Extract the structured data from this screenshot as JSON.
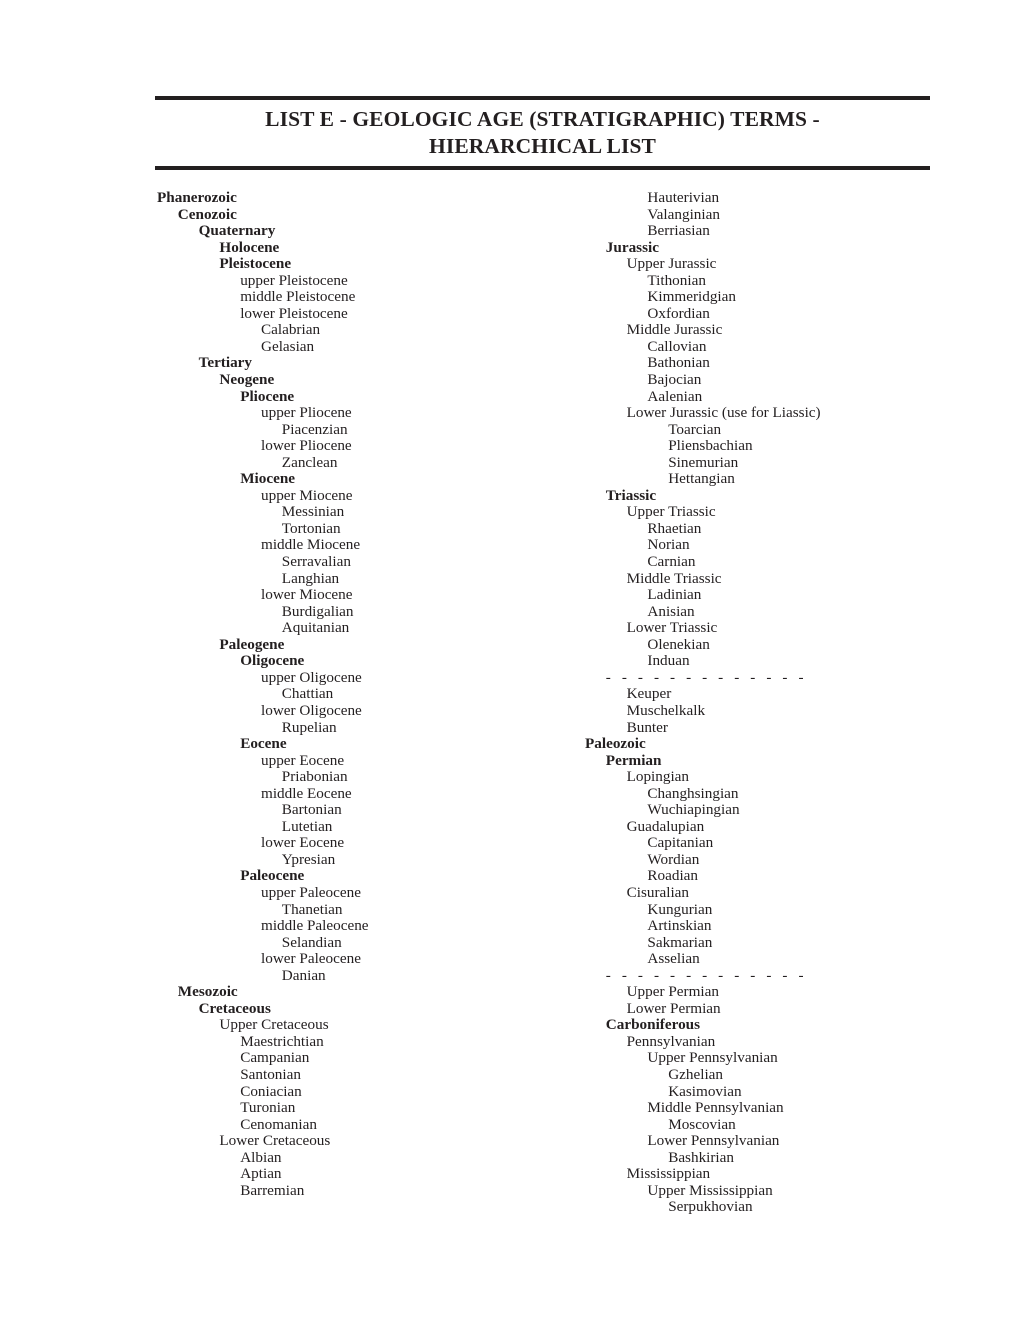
{
  "document": {
    "title_line_1": "LIST E - GEOLOGIC AGE (STRATIGRAPHIC) TERMS -",
    "title_line_2": "HIERARCHICAL LIST",
    "rule_color": "#231f20",
    "text_color": "#231f20",
    "background_color": "#ffffff"
  },
  "left_column": [
    {
      "label": "Phanerozoic",
      "level": 0,
      "bold": true
    },
    {
      "label": "Cenozoic",
      "level": 1,
      "bold": true
    },
    {
      "label": "Quaternary",
      "level": 2,
      "bold": true
    },
    {
      "label": "Holocene",
      "level": 3,
      "bold": true
    },
    {
      "label": "Pleistocene",
      "level": 3,
      "bold": true
    },
    {
      "label": "upper Pleistocene",
      "level": 4,
      "bold": false
    },
    {
      "label": "middle Pleistocene",
      "level": 4,
      "bold": false
    },
    {
      "label": "lower Pleistocene",
      "level": 4,
      "bold": false
    },
    {
      "label": "Calabrian",
      "level": 5,
      "bold": false
    },
    {
      "label": "Gelasian",
      "level": 5,
      "bold": false
    },
    {
      "label": "Tertiary",
      "level": 2,
      "bold": true
    },
    {
      "label": "Neogene",
      "level": 3,
      "bold": true
    },
    {
      "label": "Pliocene",
      "level": 4,
      "bold": true
    },
    {
      "label": "upper Pliocene",
      "level": 5,
      "bold": false
    },
    {
      "label": "Piacenzian",
      "level": 6,
      "bold": false
    },
    {
      "label": "lower Pliocene",
      "level": 5,
      "bold": false
    },
    {
      "label": "Zanclean",
      "level": 6,
      "bold": false
    },
    {
      "label": "Miocene",
      "level": 4,
      "bold": true
    },
    {
      "label": "upper Miocene",
      "level": 5,
      "bold": false
    },
    {
      "label": "Messinian",
      "level": 6,
      "bold": false
    },
    {
      "label": "Tortonian",
      "level": 6,
      "bold": false
    },
    {
      "label": "middle Miocene",
      "level": 5,
      "bold": false
    },
    {
      "label": "Serravalian",
      "level": 6,
      "bold": false
    },
    {
      "label": "Langhian",
      "level": 6,
      "bold": false
    },
    {
      "label": "lower Miocene",
      "level": 5,
      "bold": false
    },
    {
      "label": "Burdigalian",
      "level": 6,
      "bold": false
    },
    {
      "label": "Aquitanian",
      "level": 6,
      "bold": false
    },
    {
      "label": "Paleogene",
      "level": 3,
      "bold": true
    },
    {
      "label": "Oligocene",
      "level": 4,
      "bold": true
    },
    {
      "label": "upper Oligocene",
      "level": 5,
      "bold": false
    },
    {
      "label": "Chattian",
      "level": 6,
      "bold": false
    },
    {
      "label": "lower Oligocene",
      "level": 5,
      "bold": false
    },
    {
      "label": "Rupelian",
      "level": 6,
      "bold": false
    },
    {
      "label": "Eocene",
      "level": 4,
      "bold": true
    },
    {
      "label": "upper Eocene",
      "level": 5,
      "bold": false
    },
    {
      "label": "Priabonian",
      "level": 6,
      "bold": false
    },
    {
      "label": "middle Eocene",
      "level": 5,
      "bold": false
    },
    {
      "label": "Bartonian",
      "level": 6,
      "bold": false
    },
    {
      "label": "Lutetian",
      "level": 6,
      "bold": false
    },
    {
      "label": "lower Eocene",
      "level": 5,
      "bold": false
    },
    {
      "label": "Ypresian",
      "level": 6,
      "bold": false
    },
    {
      "label": "Paleocene",
      "level": 4,
      "bold": true
    },
    {
      "label": "upper Paleocene",
      "level": 5,
      "bold": false
    },
    {
      "label": "Thanetian",
      "level": 6,
      "bold": false
    },
    {
      "label": "middle Paleocene",
      "level": 5,
      "bold": false
    },
    {
      "label": "Selandian",
      "level": 6,
      "bold": false
    },
    {
      "label": "lower Paleocene",
      "level": 5,
      "bold": false
    },
    {
      "label": "Danian",
      "level": 6,
      "bold": false
    },
    {
      "label": "Mesozoic",
      "level": 1,
      "bold": true
    },
    {
      "label": "Cretaceous",
      "level": 2,
      "bold": true
    },
    {
      "label": "Upper Cretaceous",
      "level": 3,
      "bold": false
    },
    {
      "label": "Maestrichtian",
      "level": 4,
      "bold": false
    },
    {
      "label": "Campanian",
      "level": 4,
      "bold": false
    },
    {
      "label": "Santonian",
      "level": 4,
      "bold": false
    },
    {
      "label": "Coniacian",
      "level": 4,
      "bold": false
    },
    {
      "label": "Turonian",
      "level": 4,
      "bold": false
    },
    {
      "label": "Cenomanian",
      "level": 4,
      "bold": false
    },
    {
      "label": "Lower Cretaceous",
      "level": 3,
      "bold": false
    },
    {
      "label": "Albian",
      "level": 4,
      "bold": false
    },
    {
      "label": "Aptian",
      "level": 4,
      "bold": false
    },
    {
      "label": "Barremian",
      "level": 4,
      "bold": false
    }
  ],
  "right_column": [
    {
      "label": "Hauterivian",
      "level": 3,
      "bold": false
    },
    {
      "label": "Valanginian",
      "level": 3,
      "bold": false
    },
    {
      "label": "Berriasian",
      "level": 3,
      "bold": false
    },
    {
      "label": "Jurassic",
      "level": 1,
      "bold": true
    },
    {
      "label": "Upper Jurassic",
      "level": 2,
      "bold": false
    },
    {
      "label": "Tithonian",
      "level": 3,
      "bold": false
    },
    {
      "label": "Kimmeridgian",
      "level": 3,
      "bold": false
    },
    {
      "label": "Oxfordian",
      "level": 3,
      "bold": false
    },
    {
      "label": "Middle Jurassic",
      "level": 2,
      "bold": false
    },
    {
      "label": "Callovian",
      "level": 3,
      "bold": false
    },
    {
      "label": "Bathonian",
      "level": 3,
      "bold": false
    },
    {
      "label": "Bajocian",
      "level": 3,
      "bold": false
    },
    {
      "label": "Aalenian",
      "level": 3,
      "bold": false
    },
    {
      "label": "Lower Jurassic (use for Liassic)",
      "level": 2,
      "bold": false
    },
    {
      "label": "Toarcian",
      "level": 4,
      "bold": false
    },
    {
      "label": "Pliensbachian",
      "level": 4,
      "bold": false
    },
    {
      "label": "Sinemurian",
      "level": 4,
      "bold": false
    },
    {
      "label": "Hettangian",
      "level": 4,
      "bold": false
    },
    {
      "label": "Triassic",
      "level": 1,
      "bold": true
    },
    {
      "label": "Upper Triassic",
      "level": 2,
      "bold": false
    },
    {
      "label": "Rhaetian",
      "level": 3,
      "bold": false
    },
    {
      "label": "Norian",
      "level": 3,
      "bold": false
    },
    {
      "label": "Carnian",
      "level": 3,
      "bold": false
    },
    {
      "label": "Middle Triassic",
      "level": 2,
      "bold": false
    },
    {
      "label": "Ladinian",
      "level": 3,
      "bold": false
    },
    {
      "label": "Anisian",
      "level": 3,
      "bold": false
    },
    {
      "label": "Lower Triassic",
      "level": 2,
      "bold": false
    },
    {
      "label": "Olenekian",
      "level": 3,
      "bold": false
    },
    {
      "label": "Induan",
      "level": 3,
      "bold": false
    },
    {
      "label": "- - - - - - - - - - - - -",
      "level": 1,
      "bold": false,
      "separator": true
    },
    {
      "label": "Keuper",
      "level": 2,
      "bold": false
    },
    {
      "label": "Muschelkalk",
      "level": 2,
      "bold": false
    },
    {
      "label": "Bunter",
      "level": 2,
      "bold": false
    },
    {
      "label": "Paleozoic",
      "level": 0,
      "bold": true
    },
    {
      "label": "Permian",
      "level": 1,
      "bold": true
    },
    {
      "label": "Lopingian",
      "level": 2,
      "bold": false
    },
    {
      "label": "Changhsingian",
      "level": 3,
      "bold": false
    },
    {
      "label": "Wuchiapingian",
      "level": 3,
      "bold": false
    },
    {
      "label": "Guadalupian",
      "level": 2,
      "bold": false
    },
    {
      "label": "Capitanian",
      "level": 3,
      "bold": false
    },
    {
      "label": "Wordian",
      "level": 3,
      "bold": false
    },
    {
      "label": "Roadian",
      "level": 3,
      "bold": false
    },
    {
      "label": "Cisuralian",
      "level": 2,
      "bold": false
    },
    {
      "label": "Kungurian",
      "level": 3,
      "bold": false
    },
    {
      "label": "Artinskian",
      "level": 3,
      "bold": false
    },
    {
      "label": "Sakmarian",
      "level": 3,
      "bold": false
    },
    {
      "label": "Asselian",
      "level": 3,
      "bold": false
    },
    {
      "label": "- - - - - - - - - - - - -",
      "level": 1,
      "bold": false,
      "separator": true
    },
    {
      "label": "Upper Permian",
      "level": 2,
      "bold": false
    },
    {
      "label": "Lower Permian",
      "level": 2,
      "bold": false
    },
    {
      "label": "Carboniferous",
      "level": 1,
      "bold": true
    },
    {
      "label": "Pennsylvanian",
      "level": 2,
      "bold": false
    },
    {
      "label": "Upper Pennsylvanian",
      "level": 3,
      "bold": false
    },
    {
      "label": "Gzhelian",
      "level": 4,
      "bold": false
    },
    {
      "label": "Kasimovian",
      "level": 4,
      "bold": false
    },
    {
      "label": "Middle Pennsylvanian",
      "level": 3,
      "bold": false
    },
    {
      "label": "Moscovian",
      "level": 4,
      "bold": false
    },
    {
      "label": "Lower Pennsylvanian",
      "level": 3,
      "bold": false
    },
    {
      "label": "Bashkirian",
      "level": 4,
      "bold": false
    },
    {
      "label": "Mississippian",
      "level": 2,
      "bold": false
    },
    {
      "label": "Upper Mississippian",
      "level": 3,
      "bold": false
    },
    {
      "label": "Serpukhovian",
      "level": 4,
      "bold": false
    }
  ]
}
